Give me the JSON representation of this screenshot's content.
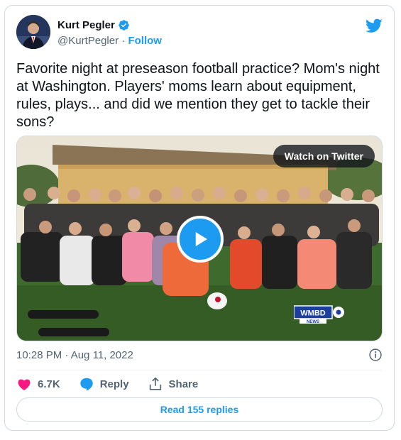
{
  "author": {
    "name": "Kurt Pegler",
    "handle": "@KurtPegler",
    "separator": "·",
    "follow_label": "Follow"
  },
  "tweet": {
    "text": "Favorite night at preseason football practice? Mom's night at Washington. Players' moms learn about equipment, rules, plays... and did we mention they get to tackle their sons?"
  },
  "media": {
    "watch_label": "Watch on Twitter",
    "station_logo_text": "WMBD",
    "station_logo_sub": "NEWS"
  },
  "meta": {
    "timestamp": "10:28 PM · Aug 11, 2022"
  },
  "actions": {
    "likes": "6.7K",
    "reply_label": "Reply",
    "share_label": "Share"
  },
  "read_replies_label": "Read 155 replies",
  "colors": {
    "accent": "#1d9bf0",
    "like": "#f91880",
    "text_secondary": "#536471",
    "border": "#cfd9de"
  },
  "icons": [
    "verified-badge-icon",
    "twitter-bird-icon",
    "play-icon",
    "info-icon",
    "heart-icon",
    "reply-icon",
    "share-icon"
  ]
}
